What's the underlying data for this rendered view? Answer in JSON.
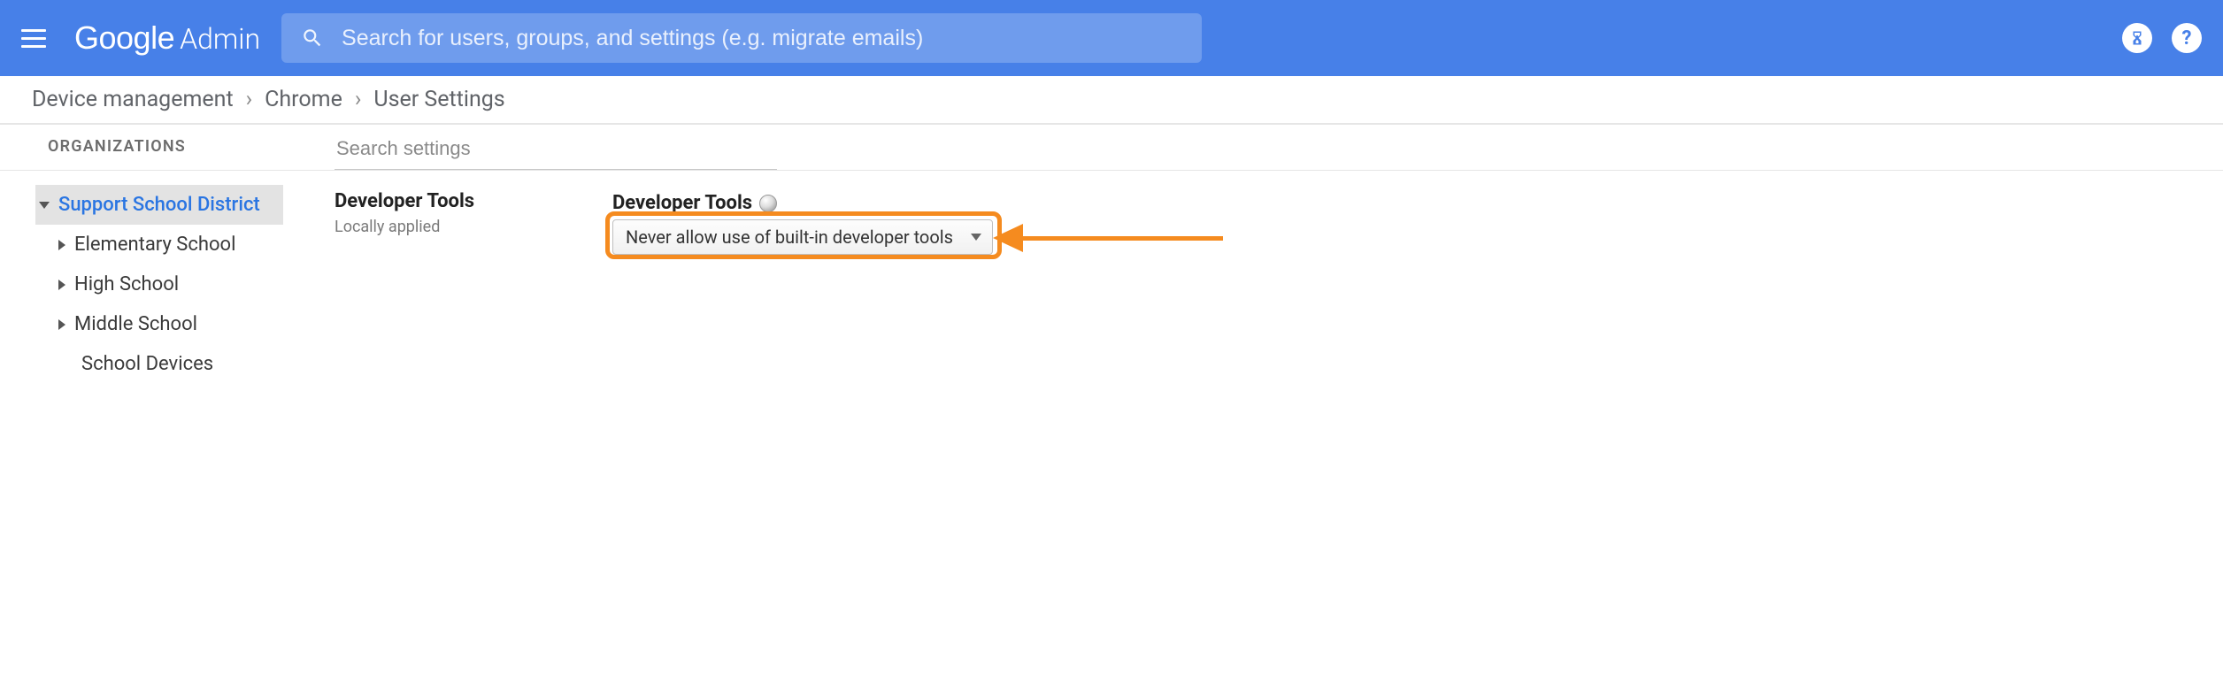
{
  "header": {
    "logo_primary": "Google",
    "logo_secondary": "Admin",
    "search_placeholder": "Search for users, groups, and settings (e.g. migrate emails)"
  },
  "breadcrumb": {
    "items": [
      "Device management",
      "Chrome",
      "User Settings"
    ]
  },
  "sidebar": {
    "heading": "ORGANIZATIONS",
    "root": {
      "label": "Support School District",
      "children": [
        {
          "label": "Elementary School",
          "expandable": true
        },
        {
          "label": "High School",
          "expandable": true
        },
        {
          "label": "Middle School",
          "expandable": true
        },
        {
          "label": "School Devices",
          "expandable": false
        }
      ]
    }
  },
  "settings_search_placeholder": "Search settings",
  "setting_section": {
    "title": "Developer Tools",
    "applied_scope": "Locally applied",
    "label": "Developer Tools",
    "dropdown_value": "Never allow use of built-in developer tools"
  },
  "colors": {
    "brand": "#4780e8",
    "highlight": "#f58b1f"
  }
}
